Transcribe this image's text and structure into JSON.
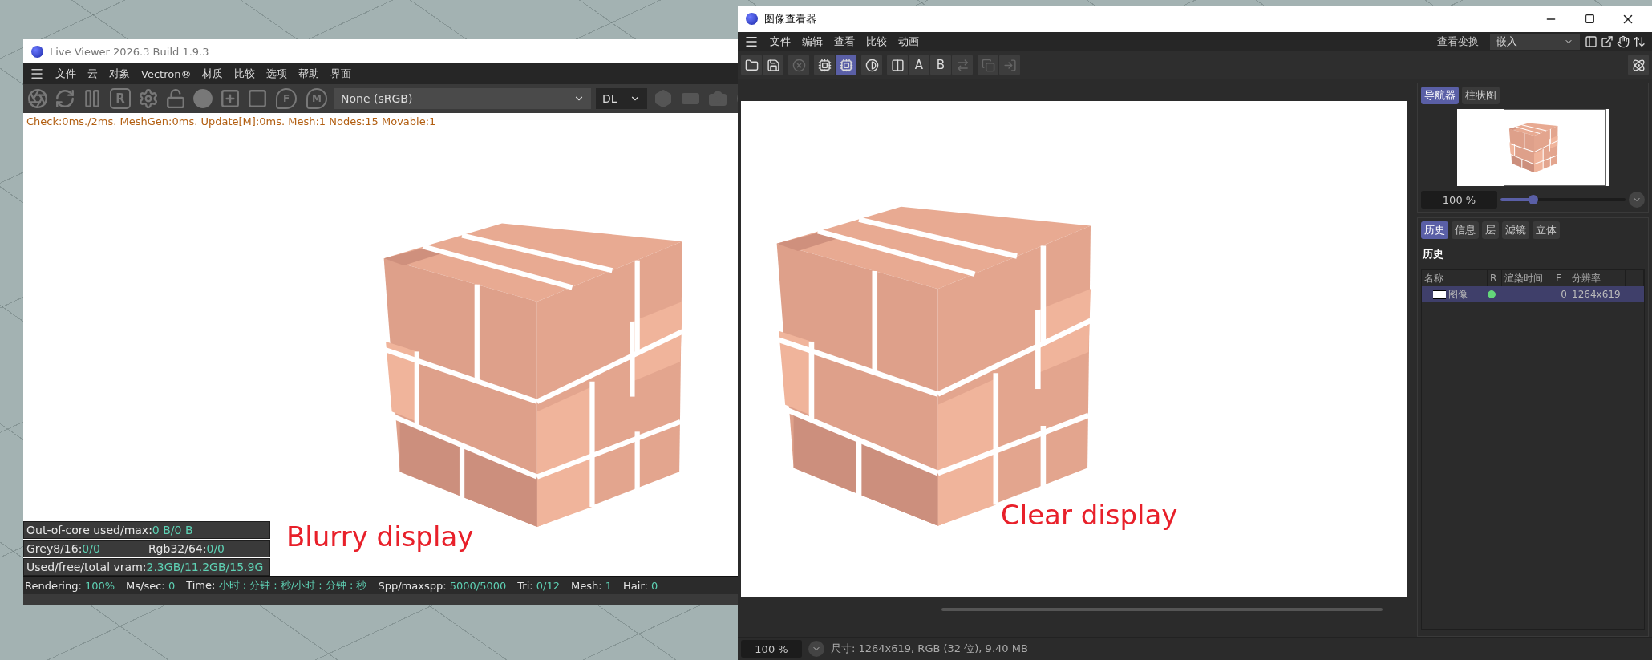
{
  "left_window": {
    "title": "Live Viewer 2026.3 Build 1.9.3",
    "menu": [
      "文件",
      "云",
      "对象",
      "Vectron®",
      "材质",
      "比较",
      "选项",
      "帮助",
      "界面"
    ],
    "toolbar": [
      {
        "kind": "aperture"
      },
      {
        "kind": "refresh"
      },
      {
        "kind": "pause"
      },
      {
        "kind": "letter",
        "glyph": "R"
      },
      {
        "kind": "gear"
      },
      {
        "kind": "lock"
      },
      {
        "kind": "sphere"
      },
      {
        "kind": "add"
      },
      {
        "kind": "frame"
      },
      {
        "kind": "pin",
        "glyph": "F"
      },
      {
        "kind": "pin",
        "glyph": "M"
      }
    ],
    "color_space": "None (sRGB)",
    "mode": "DL",
    "toolbar_extra": [
      {
        "kind": "hexagon"
      },
      {
        "kind": "rectangle"
      },
      {
        "kind": "camera"
      },
      {
        "kind": "dot"
      }
    ],
    "info_line": "Check:0ms./2ms. MeshGen:0ms. Update[M]:0ms. Mesh:1 Nodes:15 Movable:1",
    "overlay_stats": [
      {
        "items": [
          {
            "label": "Out-of-core used/max:",
            "value": "0 B/0 B"
          }
        ]
      },
      {
        "items": [
          {
            "label": "Grey8/16:",
            "value": "0/0"
          },
          {
            "label": "Rgb32/64:",
            "value": "0/0"
          }
        ]
      },
      {
        "items": [
          {
            "label": "Used/free/total vram:",
            "value": "2.3GB/11.2GB/15.9G"
          }
        ]
      }
    ],
    "annotation": "Blurry display",
    "status": [
      {
        "label": "Rendering:",
        "value": "100%"
      },
      {
        "label": "Ms/sec:",
        "value": "0"
      },
      {
        "label": "Time:",
        "value": "小时 : 分钟 : 秒/小时 : 分钟 : 秒"
      },
      {
        "label": "Spp/maxspp:",
        "value": "5000/5000"
      },
      {
        "label": "Tri:",
        "value": "0/12"
      },
      {
        "label": "Mesh:",
        "value": "1"
      },
      {
        "label": "Hair:",
        "value": "0"
      }
    ]
  },
  "right_window": {
    "title": "图像查看器",
    "menu": [
      "文件",
      "编辑",
      "查看",
      "比较",
      "动画"
    ],
    "view_transform": {
      "label": "查看变换",
      "value": "嵌入"
    },
    "toolbar_groups": [
      {
        "tools": [
          {
            "kind": "folder",
            "selected": false,
            "disabled": false
          },
          {
            "kind": "save",
            "selected": false,
            "disabled": false
          }
        ]
      },
      {
        "tools": [
          {
            "kind": "cancel",
            "selected": false,
            "disabled": true
          }
        ]
      },
      {
        "tools": [
          {
            "kind": "chip",
            "selected": false,
            "disabled": false
          },
          {
            "kind": "chip",
            "selected": true,
            "disabled": false
          }
        ]
      },
      {
        "tools": [
          {
            "kind": "contrast",
            "selected": false,
            "disabled": false
          }
        ]
      },
      {
        "tools": [
          {
            "kind": "split",
            "selected": false,
            "disabled": false
          },
          {
            "kind": "letter",
            "glyph": "A",
            "selected": false,
            "disabled": false
          },
          {
            "kind": "letter",
            "glyph": "B",
            "selected": false,
            "disabled": false
          },
          {
            "kind": "swap",
            "selected": false,
            "disabled": true
          }
        ]
      },
      {
        "tools": [
          {
            "kind": "layers",
            "selected": false,
            "disabled": true
          },
          {
            "kind": "export",
            "selected": false,
            "disabled": true
          }
        ]
      }
    ],
    "annotation": "Clear display",
    "panel_tabs": [
      {
        "label": "导航器",
        "selected": true
      },
      {
        "label": "柱状图",
        "selected": false
      }
    ],
    "navigator": {
      "zoom": "100 %",
      "level": 0.26
    },
    "history_tabs": [
      {
        "label": "历史",
        "selected": true
      },
      {
        "label": "信息",
        "selected": false
      },
      {
        "label": "层",
        "selected": false
      },
      {
        "label": "滤镜",
        "selected": false
      },
      {
        "label": "立体",
        "selected": false
      }
    ],
    "history": {
      "heading": "历史",
      "columns": [
        "名称",
        "R",
        "渲染时间",
        "F",
        "分辨率"
      ],
      "rows": [
        {
          "name": "图像",
          "ready": true,
          "f": "0",
          "resolution": "1264x619",
          "selected": true
        }
      ]
    },
    "zoom": "100 %",
    "image_info": "尺寸: 1264x619, RGB (32 位), 9.40 MB"
  }
}
